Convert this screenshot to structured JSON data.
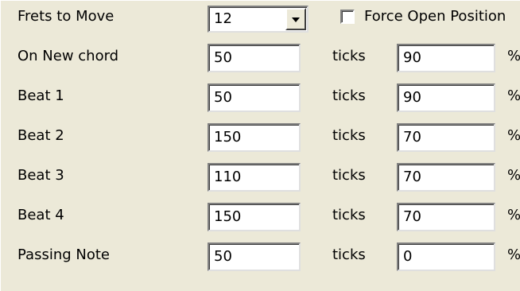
{
  "frets": {
    "label": "Frets to Move",
    "selected": "12",
    "force_open_label": "Force Open Position",
    "force_open_checked": false
  },
  "rows": [
    {
      "label": "On New chord",
      "ticks_value": "50",
      "ticks_unit": "ticks",
      "percent_value": "90",
      "percent_unit": "%"
    },
    {
      "label": "Beat 1",
      "ticks_value": "50",
      "ticks_unit": "ticks",
      "percent_value": "90",
      "percent_unit": "%"
    },
    {
      "label": "Beat 2",
      "ticks_value": "150",
      "ticks_unit": "ticks",
      "percent_value": "70",
      "percent_unit": "%"
    },
    {
      "label": "Beat 3",
      "ticks_value": "110",
      "ticks_unit": "ticks",
      "percent_value": "70",
      "percent_unit": "%"
    },
    {
      "label": "Beat 4",
      "ticks_value": "150",
      "ticks_unit": "ticks",
      "percent_value": "70",
      "percent_unit": "%"
    },
    {
      "label": "Passing Note",
      "ticks_value": "50",
      "ticks_unit": "ticks",
      "percent_value": "0",
      "percent_unit": "%"
    }
  ]
}
